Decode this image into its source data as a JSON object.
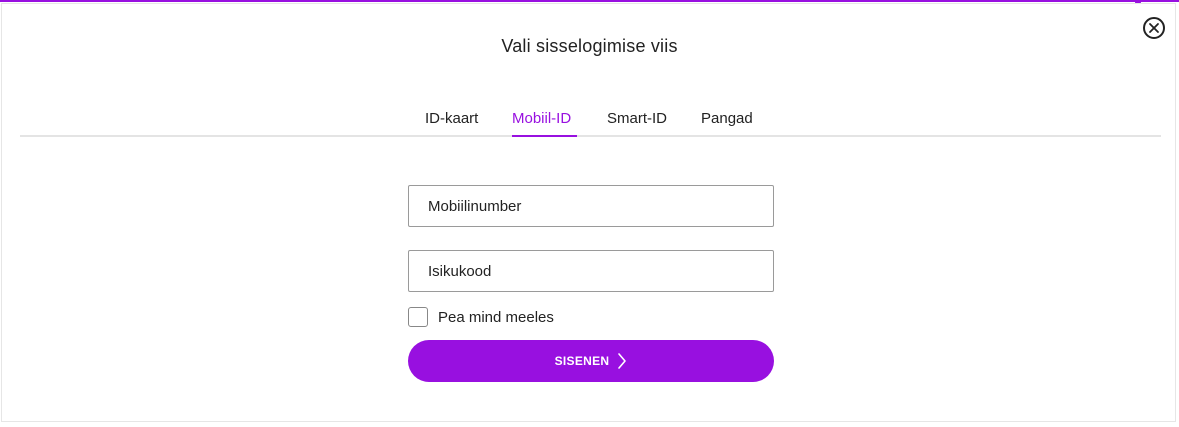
{
  "modal": {
    "title": "Vali sisselogimise viis",
    "close_icon": "close-circle-icon"
  },
  "tabs": [
    {
      "label": "ID-kaart",
      "active": false
    },
    {
      "label": "Mobiil-ID",
      "active": true
    },
    {
      "label": "Smart-ID",
      "active": false
    },
    {
      "label": "Pangad",
      "active": false
    }
  ],
  "form": {
    "phone": {
      "placeholder": "Mobiilinumber",
      "value": ""
    },
    "id_code": {
      "placeholder": "Isikukood",
      "value": ""
    },
    "remember": {
      "label": "Pea mind meeles",
      "checked": false
    },
    "submit": {
      "label": "SISENEN",
      "icon": "chevron-right-icon"
    }
  },
  "colors": {
    "accent": "#9810e0",
    "text": "#222222",
    "divider": "#e4e4e4"
  }
}
